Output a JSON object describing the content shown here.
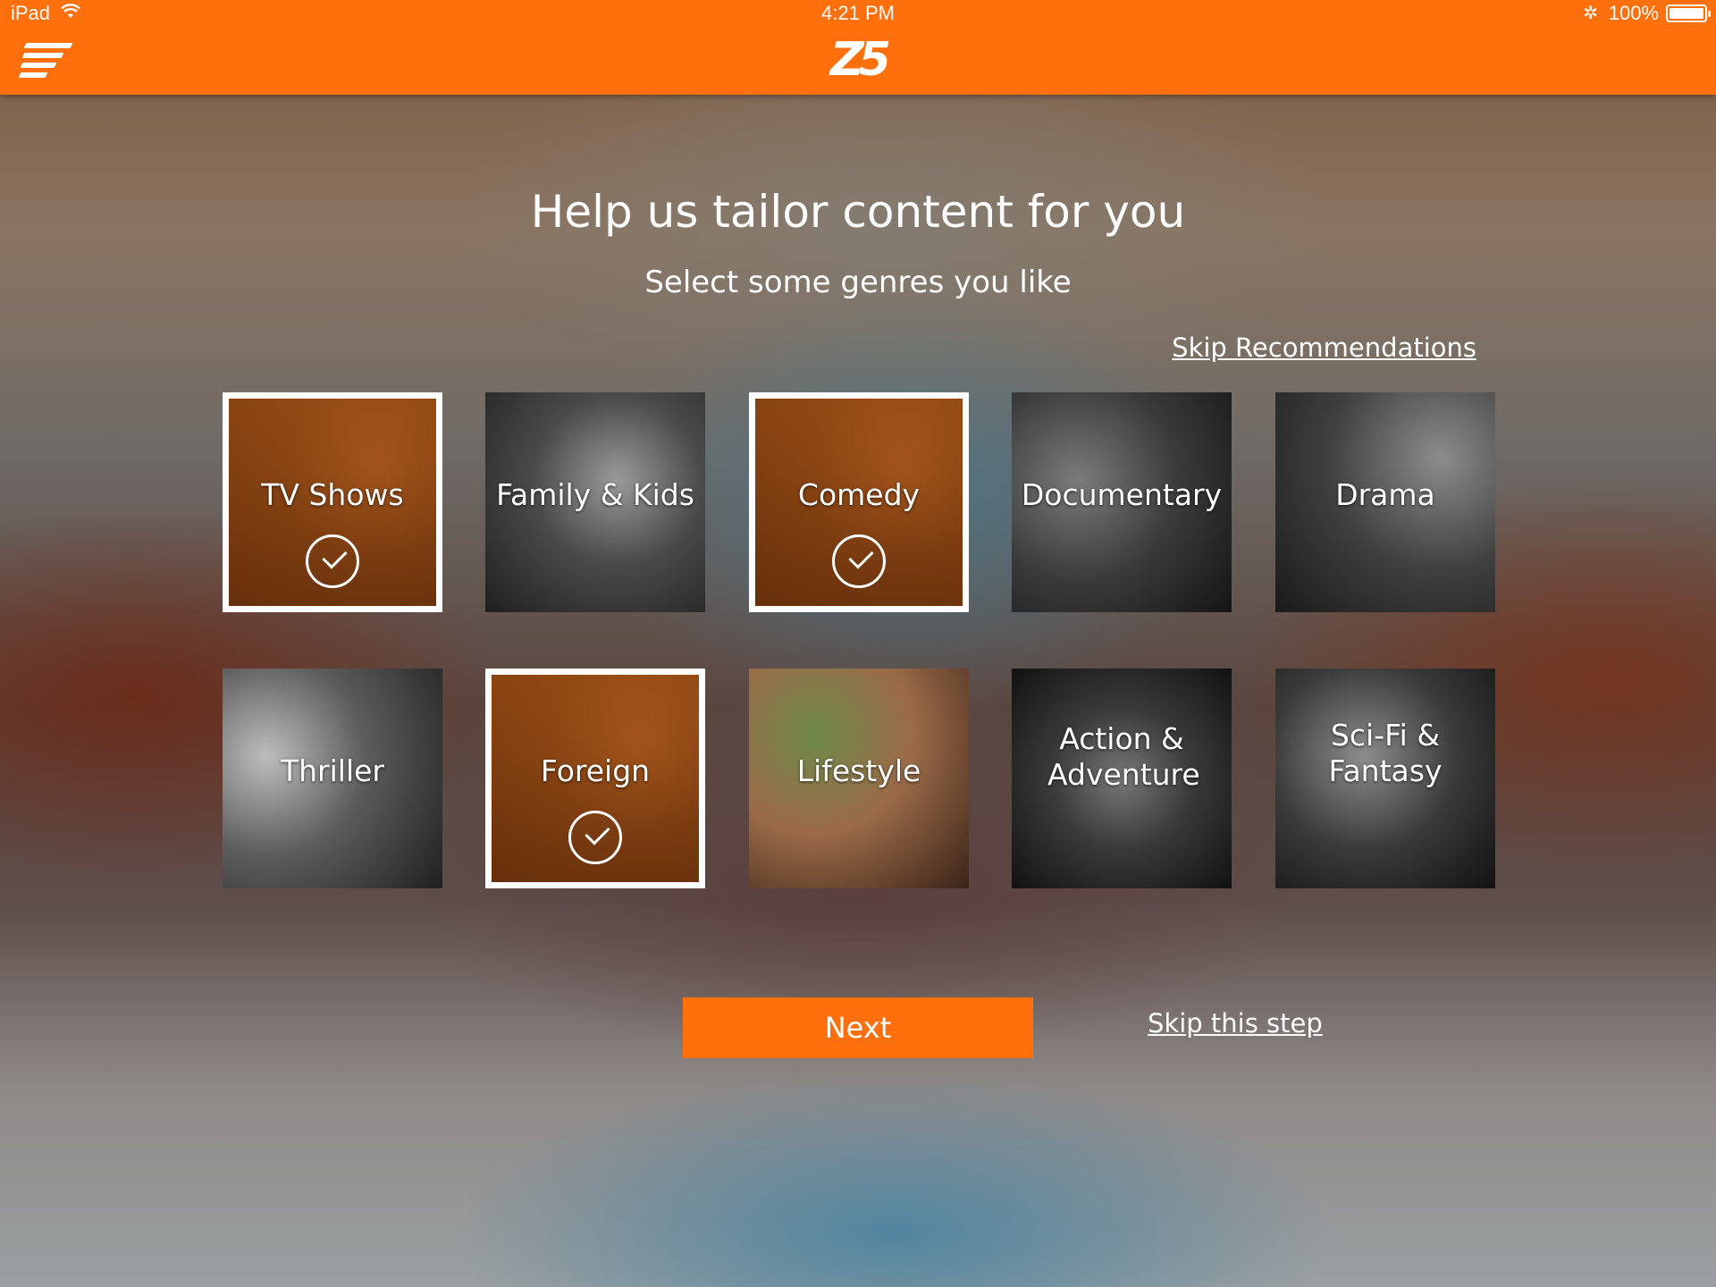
{
  "status_bar": {
    "carrier": "iPad",
    "time": "4:21 PM",
    "battery_text": "100%",
    "battery_level_percent": 100
  },
  "header": {
    "menu_icon": "hamburger-menu-icon",
    "logo_text": "Z5",
    "accent_color": "#ff6f0b"
  },
  "main": {
    "title": "Help us tailor content for you",
    "subtitle": "Select some genres you like",
    "skip_recommendations_label": "Skip Recommendations"
  },
  "genres": [
    {
      "label": "TV Shows",
      "selected": true
    },
    {
      "label": "Family & Kids",
      "selected": false
    },
    {
      "label": "Comedy",
      "selected": true
    },
    {
      "label": "Documentary",
      "selected": false
    },
    {
      "label": "Drama",
      "selected": false
    },
    {
      "label": "Thriller",
      "selected": false
    },
    {
      "label": "Foreign",
      "selected": true
    },
    {
      "label": "Lifestyle",
      "selected": false
    },
    {
      "label": "Action & Adventure",
      "selected": false
    },
    {
      "label": "Sci-Fi & Fantasy",
      "selected": false
    }
  ],
  "actions": {
    "next_label": "Next",
    "skip_step_label": "Skip this step"
  }
}
